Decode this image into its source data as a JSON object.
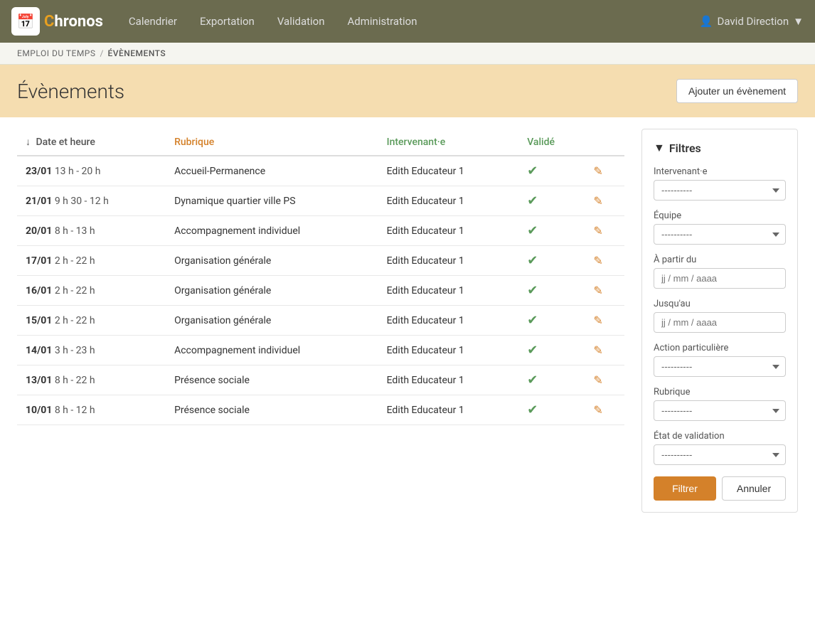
{
  "brand": {
    "name_prefix": "hronos",
    "name_c": "C",
    "logo_emoji": "📅"
  },
  "navbar": {
    "links": [
      {
        "id": "calendrier",
        "label": "Calendrier"
      },
      {
        "id": "exportation",
        "label": "Exportation"
      },
      {
        "id": "validation",
        "label": "Validation"
      },
      {
        "id": "administration",
        "label": "Administration"
      }
    ],
    "user": {
      "icon": "👤",
      "name": "David Direction",
      "caret": "▼"
    }
  },
  "breadcrumb": {
    "parent": "EMPLOI DU TEMPS",
    "separator": "/",
    "current": "ÉVÈNEMENTS"
  },
  "page_header": {
    "title": "Évènements",
    "add_button": "Ajouter un évènement"
  },
  "table": {
    "columns": [
      {
        "id": "date",
        "label": "Date et heure",
        "sortable": true,
        "sort_icon": "↓"
      },
      {
        "id": "rubrique",
        "label": "Rubrique"
      },
      {
        "id": "intervenant",
        "label": "Intervenant·e"
      },
      {
        "id": "valide",
        "label": "Validé"
      },
      {
        "id": "actions",
        "label": ""
      }
    ],
    "rows": [
      {
        "id": 1,
        "date_day": "23/01",
        "date_time": "13 h - 20 h",
        "rubrique": "Accueil-Permanence",
        "intervenant": "Edith Educateur 1",
        "valide": true
      },
      {
        "id": 2,
        "date_day": "21/01",
        "date_time": "9 h 30 - 12 h",
        "rubrique": "Dynamique quartier ville PS",
        "intervenant": "Edith Educateur 1",
        "valide": true
      },
      {
        "id": 3,
        "date_day": "20/01",
        "date_time": "8 h - 13 h",
        "rubrique": "Accompagnement individuel",
        "intervenant": "Edith Educateur 1",
        "valide": true
      },
      {
        "id": 4,
        "date_day": "17/01",
        "date_time": "2 h - 22 h",
        "rubrique": "Organisation générale",
        "intervenant": "Edith Educateur 1",
        "valide": true
      },
      {
        "id": 5,
        "date_day": "16/01",
        "date_time": "2 h - 22 h",
        "rubrique": "Organisation générale",
        "intervenant": "Edith Educateur 1",
        "valide": true
      },
      {
        "id": 6,
        "date_day": "15/01",
        "date_time": "2 h - 22 h",
        "rubrique": "Organisation générale",
        "intervenant": "Edith Educateur 1",
        "valide": true
      },
      {
        "id": 7,
        "date_day": "14/01",
        "date_time": "3 h - 23 h",
        "rubrique": "Accompagnement individuel",
        "intervenant": "Edith Educateur 1",
        "valide": true
      },
      {
        "id": 8,
        "date_day": "13/01",
        "date_time": "8 h - 22 h",
        "rubrique": "Présence sociale",
        "intervenant": "Edith Educateur 1",
        "valide": true
      },
      {
        "id": 9,
        "date_day": "10/01",
        "date_time": "8 h - 12 h",
        "rubrique": "Présence sociale",
        "intervenant": "Edith Educateur 1",
        "valide": true
      }
    ]
  },
  "filters": {
    "title": "Filtres",
    "groups": [
      {
        "id": "intervenant",
        "label": "Intervenant·e",
        "type": "select",
        "placeholder": "----------"
      },
      {
        "id": "equipe",
        "label": "Équipe",
        "type": "select",
        "placeholder": "----------"
      },
      {
        "id": "date_from",
        "label": "À partir du",
        "type": "date",
        "placeholder": "jj / mm / aaaa"
      },
      {
        "id": "date_to",
        "label": "Jusqu'au",
        "type": "date",
        "placeholder": "jj / mm / aaaa"
      },
      {
        "id": "action_particuliere",
        "label": "Action particulière",
        "type": "select",
        "placeholder": "----------"
      },
      {
        "id": "rubrique",
        "label": "Rubrique",
        "type": "select",
        "placeholder": "----------"
      },
      {
        "id": "etat_validation",
        "label": "État de validation",
        "type": "select",
        "placeholder": "----------"
      }
    ],
    "btn_filter": "Filtrer",
    "btn_cancel": "Annuler"
  }
}
